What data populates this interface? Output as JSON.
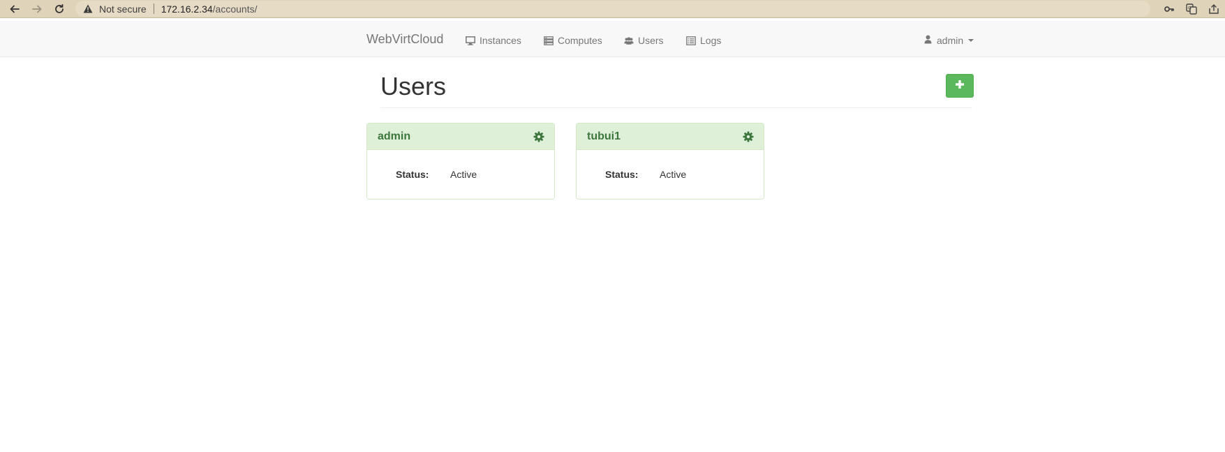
{
  "browser": {
    "security_label": "Not secure",
    "url_host": "172.16.2.34",
    "url_path": "/accounts/",
    "icons": [
      "back-icon",
      "forward-icon",
      "reload-icon",
      "warning-icon",
      "key-icon",
      "translate-icon",
      "share-icon"
    ]
  },
  "navbar": {
    "brand": "WebVirtCloud",
    "links": [
      {
        "label": "Instances",
        "icon": "monitor-icon"
      },
      {
        "label": "Computes",
        "icon": "server-icon"
      },
      {
        "label": "Users",
        "icon": "users-icon"
      },
      {
        "label": "Logs",
        "icon": "list-icon"
      }
    ],
    "user": {
      "label": "admin",
      "icon": "user-icon"
    }
  },
  "page": {
    "title": "Users",
    "add_button_icon": "plus-icon"
  },
  "users": [
    {
      "name": "admin",
      "status_label": "Status:",
      "status_value": "Active"
    },
    {
      "name": "tubui1",
      "status_label": "Status:",
      "status_value": "Active"
    }
  ],
  "colors": {
    "browser_bar": "#dfd3b9",
    "navbar_bg": "#f8f8f8",
    "success": "#5cb85c",
    "card_heading_bg": "#dff0d8",
    "card_heading_text": "#3c763d"
  }
}
